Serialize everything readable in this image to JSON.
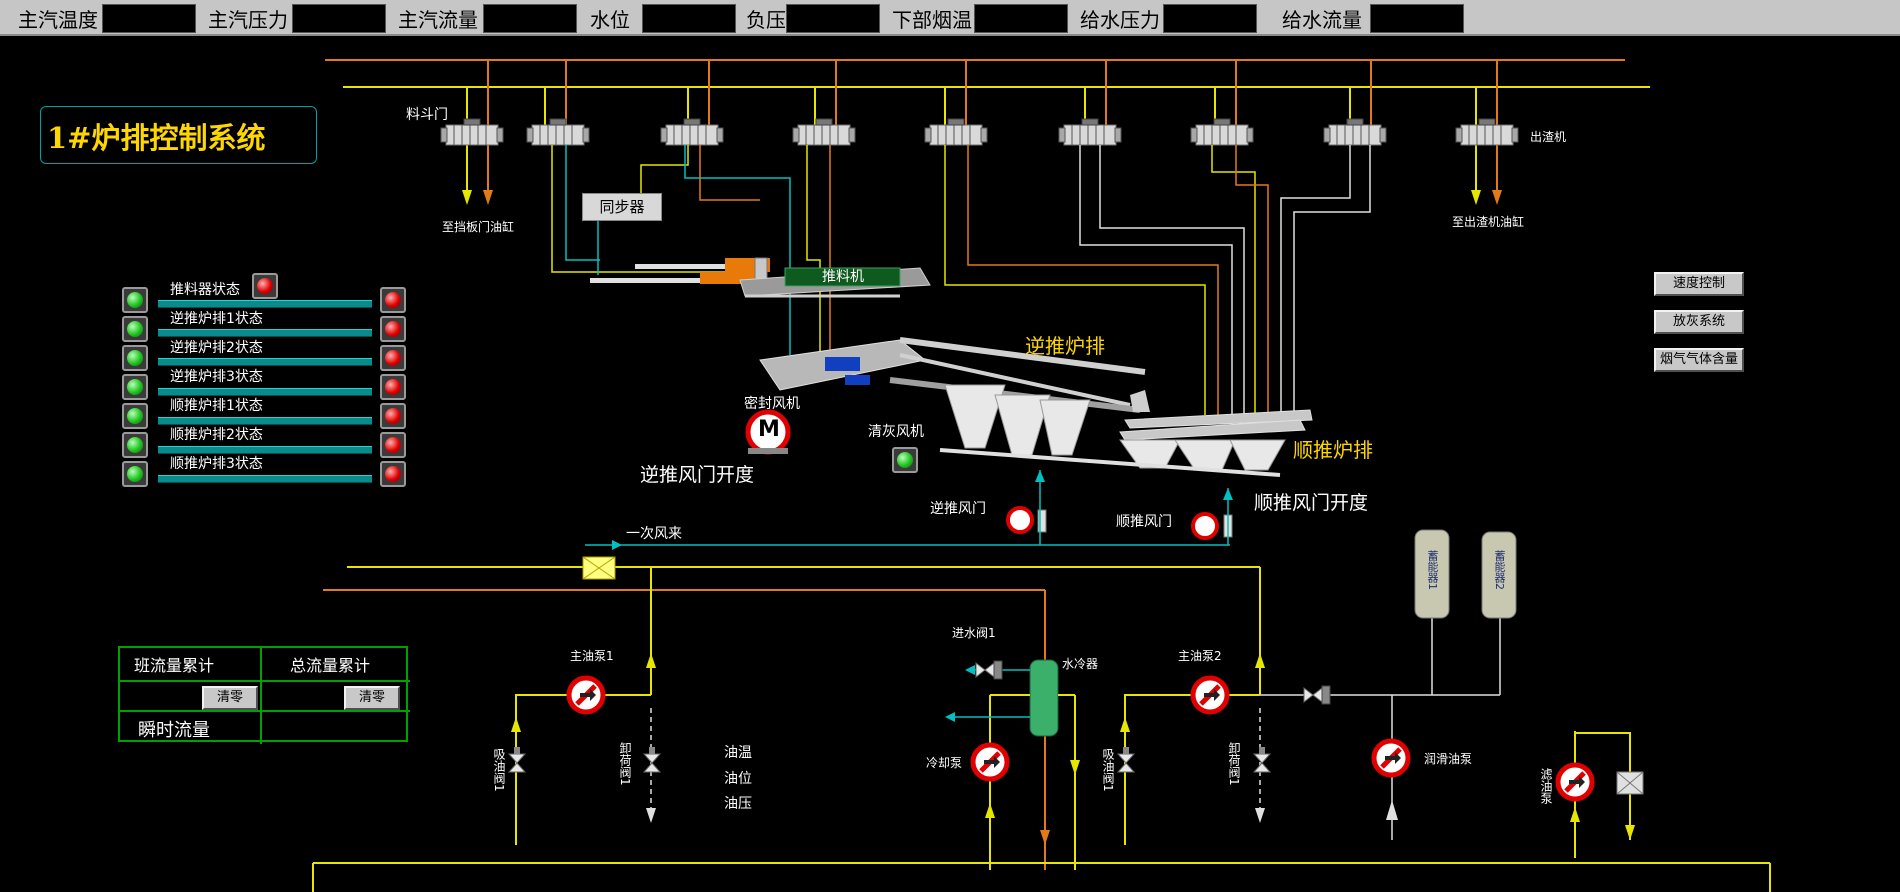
{
  "header": {
    "fields": [
      {
        "label": "主汽温度",
        "value": ""
      },
      {
        "label": "主汽压力",
        "value": ""
      },
      {
        "label": "主汽流量",
        "value": ""
      },
      {
        "label": "水位",
        "value": ""
      },
      {
        "label": "负压",
        "value": ""
      },
      {
        "label": "下部烟温",
        "value": ""
      },
      {
        "label": "给水压力",
        "value": ""
      },
      {
        "label": "给水流量",
        "value": ""
      }
    ]
  },
  "title": "1#炉排控制系统",
  "status_panel": {
    "rows": [
      {
        "label": "推料器状态",
        "left": "green",
        "right": "red"
      },
      {
        "label": "逆推炉排1状态",
        "left": "green",
        "right": "red"
      },
      {
        "label": "逆推炉排2状态",
        "left": "green",
        "right": "red"
      },
      {
        "label": "逆推炉排3状态",
        "left": "green",
        "right": "red"
      },
      {
        "label": "顺推炉排1状态",
        "left": "green",
        "right": "red"
      },
      {
        "label": "顺推炉排2状态",
        "left": "green",
        "right": "red"
      },
      {
        "label": "顺推炉排3状态",
        "left": "green",
        "right": "red"
      }
    ]
  },
  "flow_table": {
    "shift_label": "班流量累计",
    "total_label": "总流量累计",
    "clear_label_1": "清零",
    "clear_label_2": "清零",
    "instant_label": "瞬时流量"
  },
  "right_buttons": [
    "速度控制",
    "放灰系统",
    "烟气气体含量"
  ],
  "labels": {
    "hopper_door": "料斗门",
    "to_damper_cyl": "至挡板门油缸",
    "slag_remover": "出渣机",
    "to_slag_cyl": "至出渣机油缸",
    "synchronizer": "同步器",
    "pusher": "推料机",
    "reverse_grate": "逆推炉排",
    "forward_grate": "顺推炉排",
    "seal_fan": "密封风机",
    "ash_fan": "清灰风机",
    "reverse_damper_opening": "逆推风门开度",
    "forward_damper_opening": "顺推风门开度",
    "reverse_damper": "逆推风门",
    "forward_damper": "顺推风门",
    "primary_air": "一次风来",
    "main_pump_1": "主油泵1",
    "main_pump_2": "主油泵2",
    "inlet_valve_1": "进水阀1",
    "water_cooler": "水冷器",
    "cooling_pump": "冷却泵",
    "lube_pump": "润滑油泵",
    "suction_valve_1a": "吸油阀1",
    "unload_valve_1a": "卸荷阀1",
    "suction_valve_1b": "吸油阀1",
    "unload_valve_1b": "卸荷阀1",
    "filter_pump": "滤油泵",
    "oil_temp": "油温",
    "oil_level": "油位",
    "oil_pressure": "油压",
    "accumulator_1": "蓄能器1",
    "accumulator_2": "蓄能器2",
    "motor_letter": "M"
  },
  "colors": {
    "orange": "#e07a1a",
    "yellow": "#e6e600",
    "cyan": "#00c0c0",
    "white_line": "#e0e0e0",
    "red_indicator": "#e00000",
    "green_indicator": "#1ec31e"
  }
}
